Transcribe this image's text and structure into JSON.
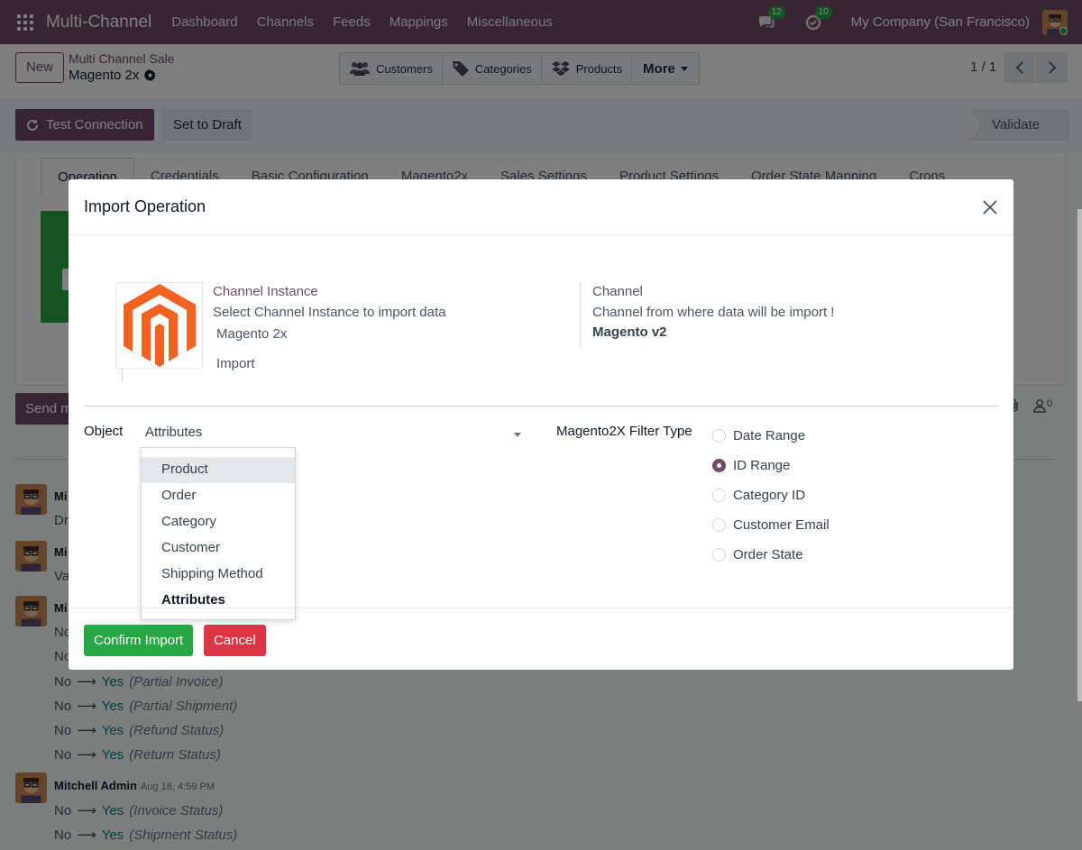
{
  "navbar": {
    "app_name": "Multi-Channel",
    "menu": [
      "Dashboard",
      "Channels",
      "Feeds",
      "Mappings",
      "Miscellaneous"
    ],
    "messages_count": "12",
    "activities_count": "10",
    "company": "My Company (San Francisco)"
  },
  "control": {
    "new_label": "New",
    "breadcrumb_parent": "Multi Channel Sale",
    "breadcrumb_current": "Magento 2x",
    "smart_buttons": [
      "Customers",
      "Categories",
      "Products",
      "More"
    ],
    "pager": "1 / 1"
  },
  "statusbar": {
    "test_connection": "Test Connection",
    "set_to_draft": "Set to Draft",
    "stage": "Validate"
  },
  "tabs": [
    "Operation",
    "Credentials",
    "Basic Configuration",
    "Magento2x",
    "Sales Settings",
    "Product Settings",
    "Order State Mapping",
    "Crons"
  ],
  "chatter": {
    "send_label": "Send m",
    "messages": [
      {
        "author": "Mi",
        "first_line": "Dr"
      },
      {
        "author": "Mi",
        "first_line": "Va"
      },
      {
        "author": "Mi",
        "first_line": "No"
      }
    ],
    "tracking_1": [
      {
        "old": "No",
        "new": "",
        "field": ""
      },
      {
        "old": "No",
        "new": "Yes",
        "field": "(Partial Invoice)"
      },
      {
        "old": "No",
        "new": "Yes",
        "field": "(Partial Shipment)"
      },
      {
        "old": "No",
        "new": "Yes",
        "field": "(Refund Status)"
      },
      {
        "old": "No",
        "new": "Yes",
        "field": "(Return Status)"
      }
    ],
    "last_author": "Mitchell Admin",
    "last_time": "Aug 18, 4:59 PM",
    "tracking_2": [
      {
        "old": "No",
        "new": "Yes",
        "field": "(Invoice Status)"
      },
      {
        "old": "No",
        "new": "Yes",
        "field": "(Shipment Status)"
      }
    ],
    "followers_count": "0"
  },
  "modal": {
    "title": "Import Operation",
    "channel_instance": {
      "label": "Channel Instance",
      "description": "Select Channel Instance to import data",
      "value": "Magento 2x",
      "operation": "Import"
    },
    "channel": {
      "label": "Channel",
      "description": "Channel from where data will be import !",
      "value": "Magento v2"
    },
    "object": {
      "label": "Object",
      "value": "Attributes",
      "options": [
        "Product",
        "Order",
        "Category",
        "Customer",
        "Shipping Method",
        "Attributes"
      ],
      "hovered": "Product",
      "selected": "Attributes"
    },
    "filter": {
      "label": "Magento2X Filter Type",
      "options": [
        "Date Range",
        "ID Range",
        "Category ID",
        "Customer Email",
        "Order State"
      ],
      "selected": "ID Range"
    },
    "confirm_label": "Confirm Import",
    "cancel_label": "Cancel"
  },
  "colors": {
    "brand": "#714b67",
    "success": "#28a745",
    "danger": "#dc3545",
    "magento_orange": "#f26322"
  }
}
